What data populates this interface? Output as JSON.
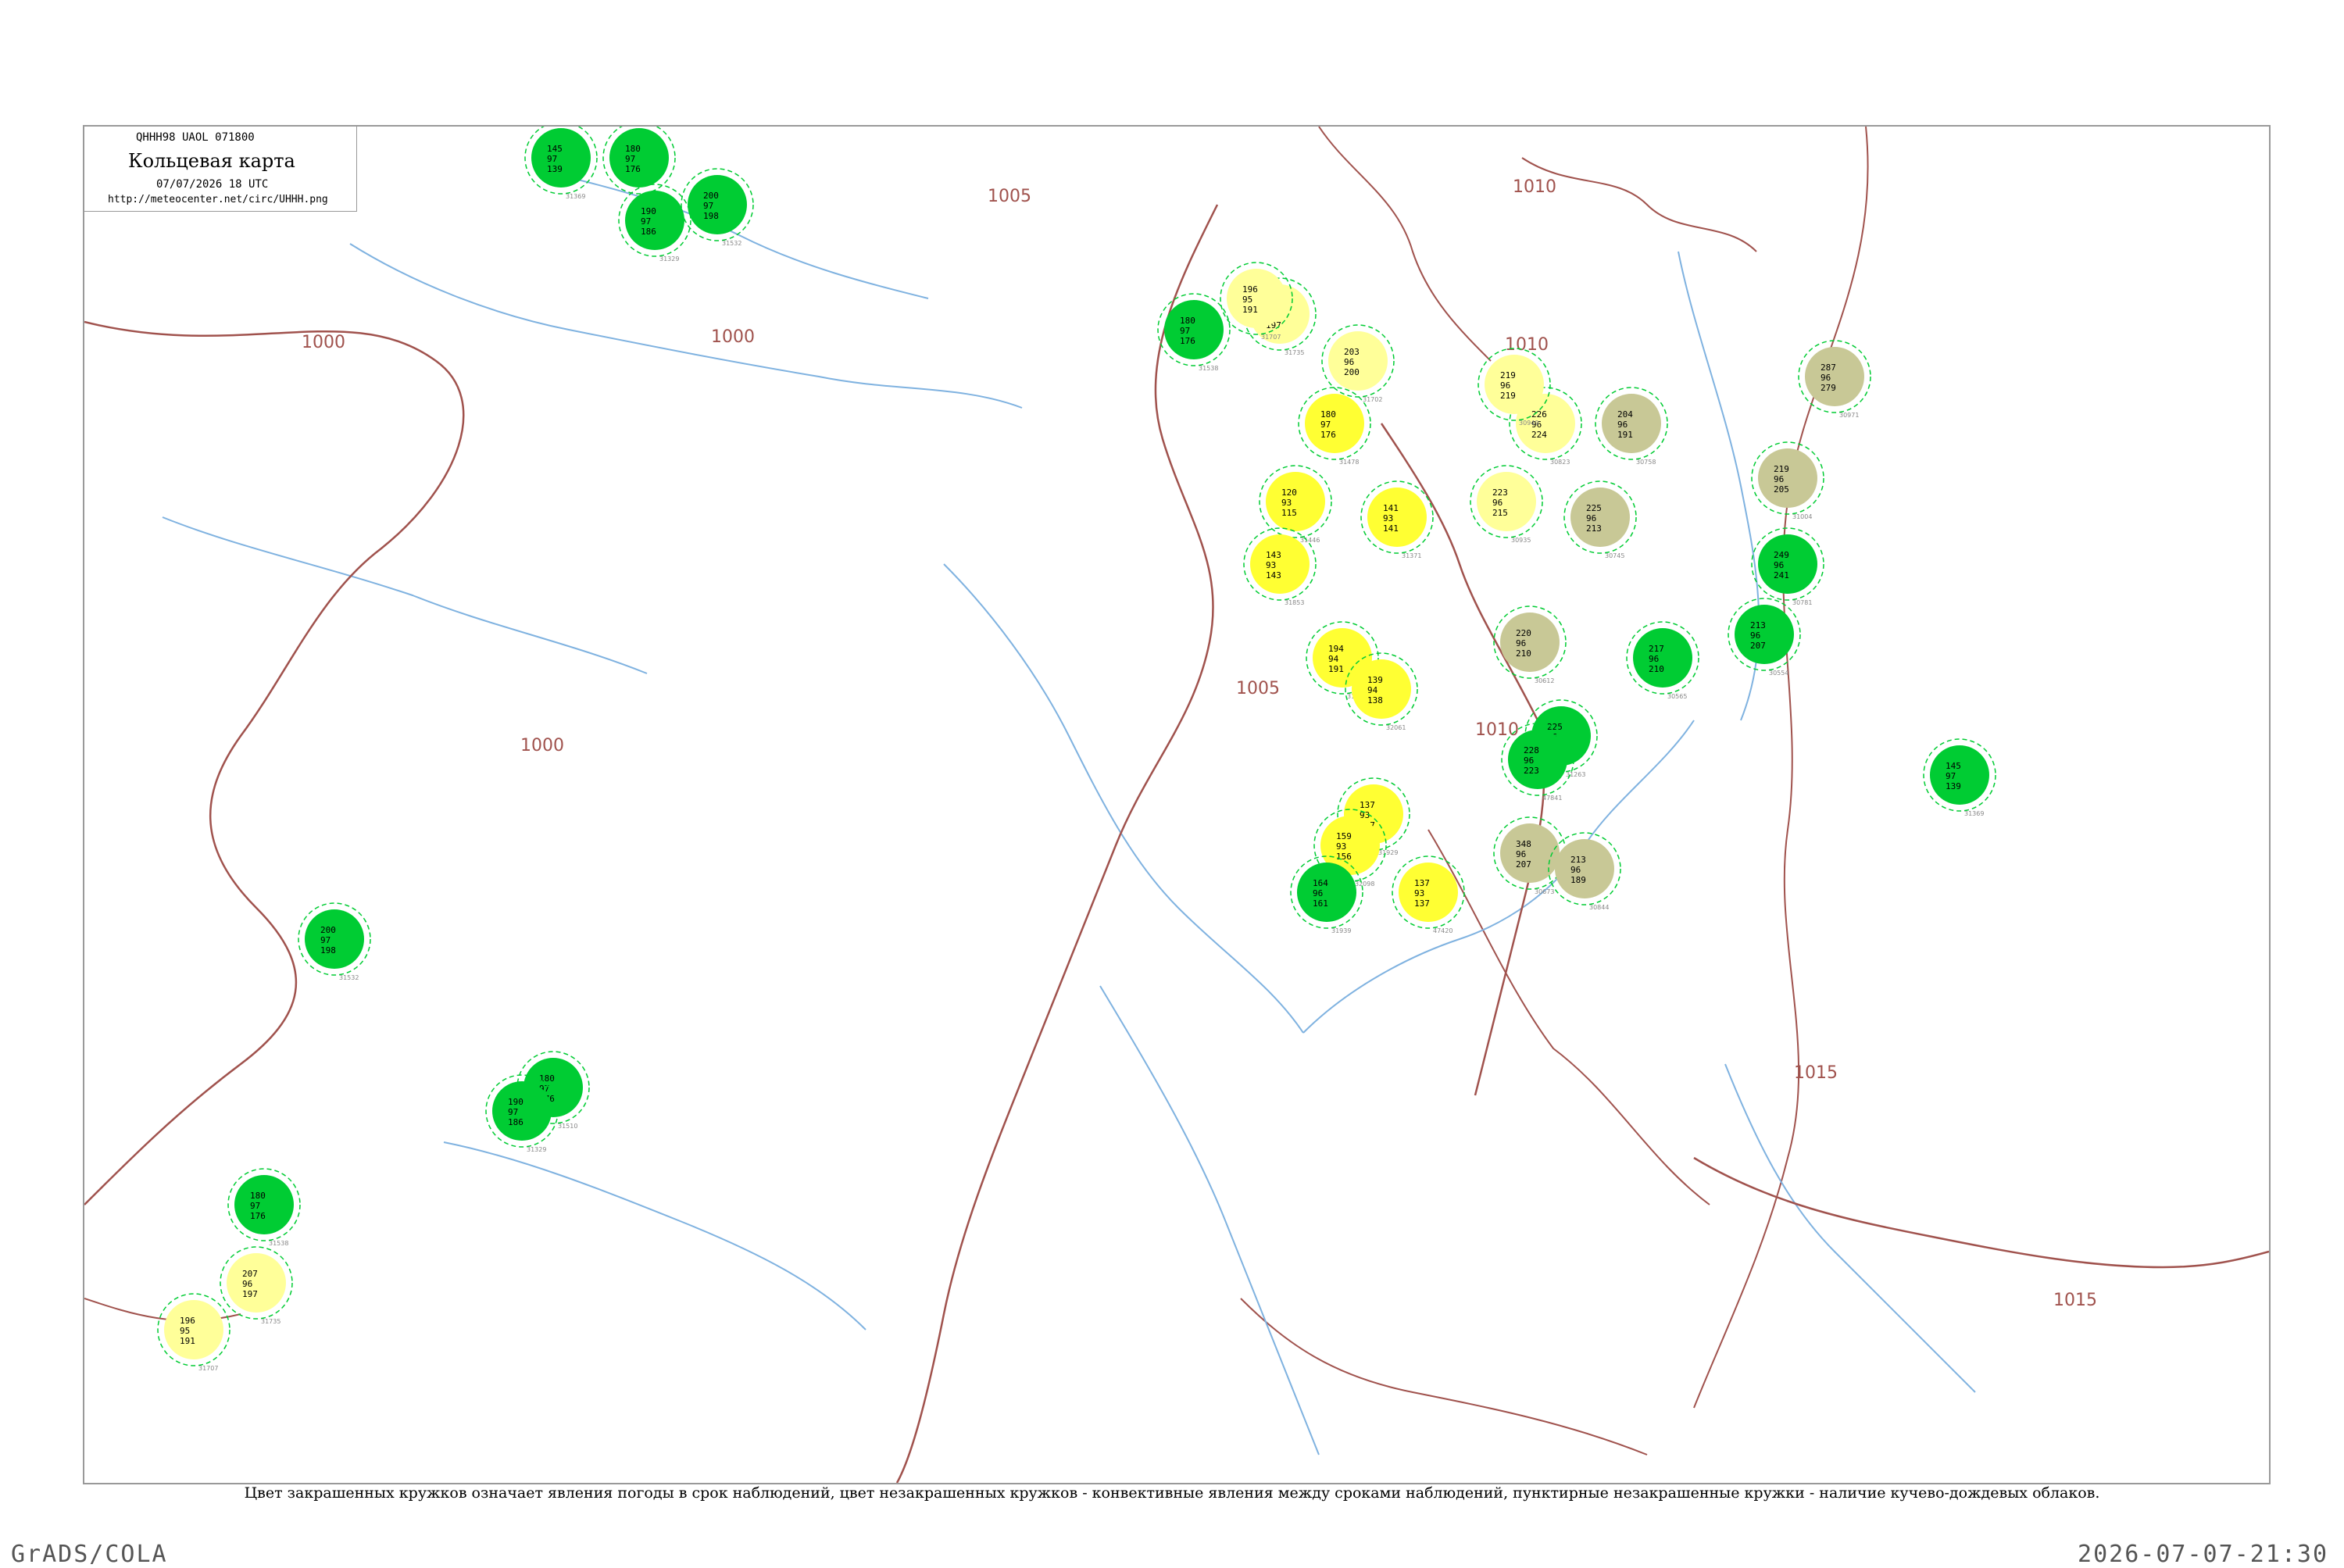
{
  "header": {
    "code": "QHHH98  UAOL  071800",
    "title": "Кольцевая карта",
    "date": "07/07/2026 18 UTC",
    "url": "http://meteocenter.net/circ/UHHH.png"
  },
  "caption": "Цвет закрашенных кружков означает явления погоды в срок наблюдений, цвет незакрашенных кружков - конвективные явления между сроками наблюдений, пунктирные незакрашенные кружки - наличие кучево-дождевых облаков.",
  "footer": {
    "left": "GrADS/COLA",
    "right": "2026-07-07-21:30"
  },
  "colors": {
    "rain": "#00cc33",
    "shower": "#ffff33",
    "haze": "#ffff99",
    "smoke": "#c8c896",
    "storm_ring": "#00cc33",
    "isobar": "#a0524d",
    "river": "#7fb2e0"
  },
  "isobars": [
    {
      "label": "1000"
    },
    {
      "label": "1005"
    },
    {
      "label": "1010"
    },
    {
      "label": "1015"
    }
  ],
  "stations": [
    {
      "id": "31369",
      "p": "145",
      "t": "97",
      "d": "139",
      "kind": "rain"
    },
    {
      "id": "31510",
      "p": "180",
      "t": "97",
      "d": "176",
      "kind": "rain"
    },
    {
      "id": "31329",
      "p": "190",
      "t": "97",
      "d": "186",
      "kind": "rain"
    },
    {
      "id": "31532",
      "p": "200",
      "t": "97",
      "d": "198",
      "kind": "rain"
    },
    {
      "id": "31538",
      "p": "180",
      "t": "97",
      "d": "176",
      "kind": "rain"
    },
    {
      "id": "31735",
      "p": "207",
      "t": "96",
      "d": "197",
      "kind": "haze"
    },
    {
      "id": "31707",
      "p": "196",
      "t": "95",
      "d": "191",
      "kind": "haze"
    },
    {
      "id": "31702",
      "p": "203",
      "t": "96",
      "d": "200",
      "kind": "haze"
    },
    {
      "id": "31478",
      "p": "180",
      "t": "97",
      "d": "176",
      "kind": "shower"
    },
    {
      "id": "31371",
      "p": "141",
      "t": "93",
      "d": "141",
      "kind": "shower"
    },
    {
      "id": "31446",
      "p": "120",
      "t": "93",
      "d": "115",
      "kind": "shower"
    },
    {
      "id": "31853",
      "p": "143",
      "t": "93",
      "d": "143",
      "kind": "shower"
    },
    {
      "id": "31913",
      "p": "194",
      "t": "94",
      "d": "191",
      "kind": "shower"
    },
    {
      "id": "32061",
      "p": "139",
      "t": "94",
      "d": "138",
      "kind": "shower"
    },
    {
      "id": "31929",
      "p": "137",
      "t": "93",
      "d": "137",
      "kind": "shower"
    },
    {
      "id": "32098",
      "p": "159",
      "t": "93",
      "d": "156",
      "kind": "shower"
    },
    {
      "id": "31939",
      "p": "164",
      "t": "96",
      "d": "161",
      "kind": "rain"
    },
    {
      "id": "47420",
      "p": "137",
      "t": "93",
      "d": "137",
      "kind": "shower"
    },
    {
      "id": "30823",
      "p": "226",
      "t": "96",
      "d": "224",
      "kind": "haze"
    },
    {
      "id": "30949",
      "p": "219",
      "t": "96",
      "d": "219",
      "kind": "haze"
    },
    {
      "id": "30935",
      "p": "223",
      "t": "96",
      "d": "215",
      "kind": "haze"
    },
    {
      "id": "30758",
      "p": "204",
      "t": "96",
      "d": "191",
      "kind": "smoke"
    },
    {
      "id": "30745",
      "p": "225",
      "t": "96",
      "d": "213",
      "kind": "smoke"
    },
    {
      "id": "30612",
      "p": "220",
      "t": "96",
      "d": "210",
      "kind": "smoke"
    },
    {
      "id": "30673",
      "p": "348",
      "t": "96",
      "d": "207",
      "kind": "smoke"
    },
    {
      "id": "30844",
      "p": "213",
      "t": "96",
      "d": "189",
      "kind": "smoke"
    },
    {
      "id": "30971",
      "p": "287",
      "t": "96",
      "d": "279",
      "kind": "smoke"
    },
    {
      "id": "31004",
      "p": "219",
      "t": "96",
      "d": "205",
      "kind": "smoke"
    },
    {
      "id": "30781",
      "p": "249",
      "t": "96",
      "d": "241",
      "kind": "rain"
    },
    {
      "id": "30554",
      "p": "213",
      "t": "96",
      "d": "207",
      "kind": "rain"
    },
    {
      "id": "30565",
      "p": "217",
      "t": "96",
      "d": "210",
      "kind": "rain"
    },
    {
      "id": "31263",
      "p": "225",
      "t": "96",
      "d": "222",
      "kind": "rain"
    },
    {
      "id": "47841",
      "p": "228",
      "t": "96",
      "d": "223",
      "kind": "rain"
    }
  ]
}
